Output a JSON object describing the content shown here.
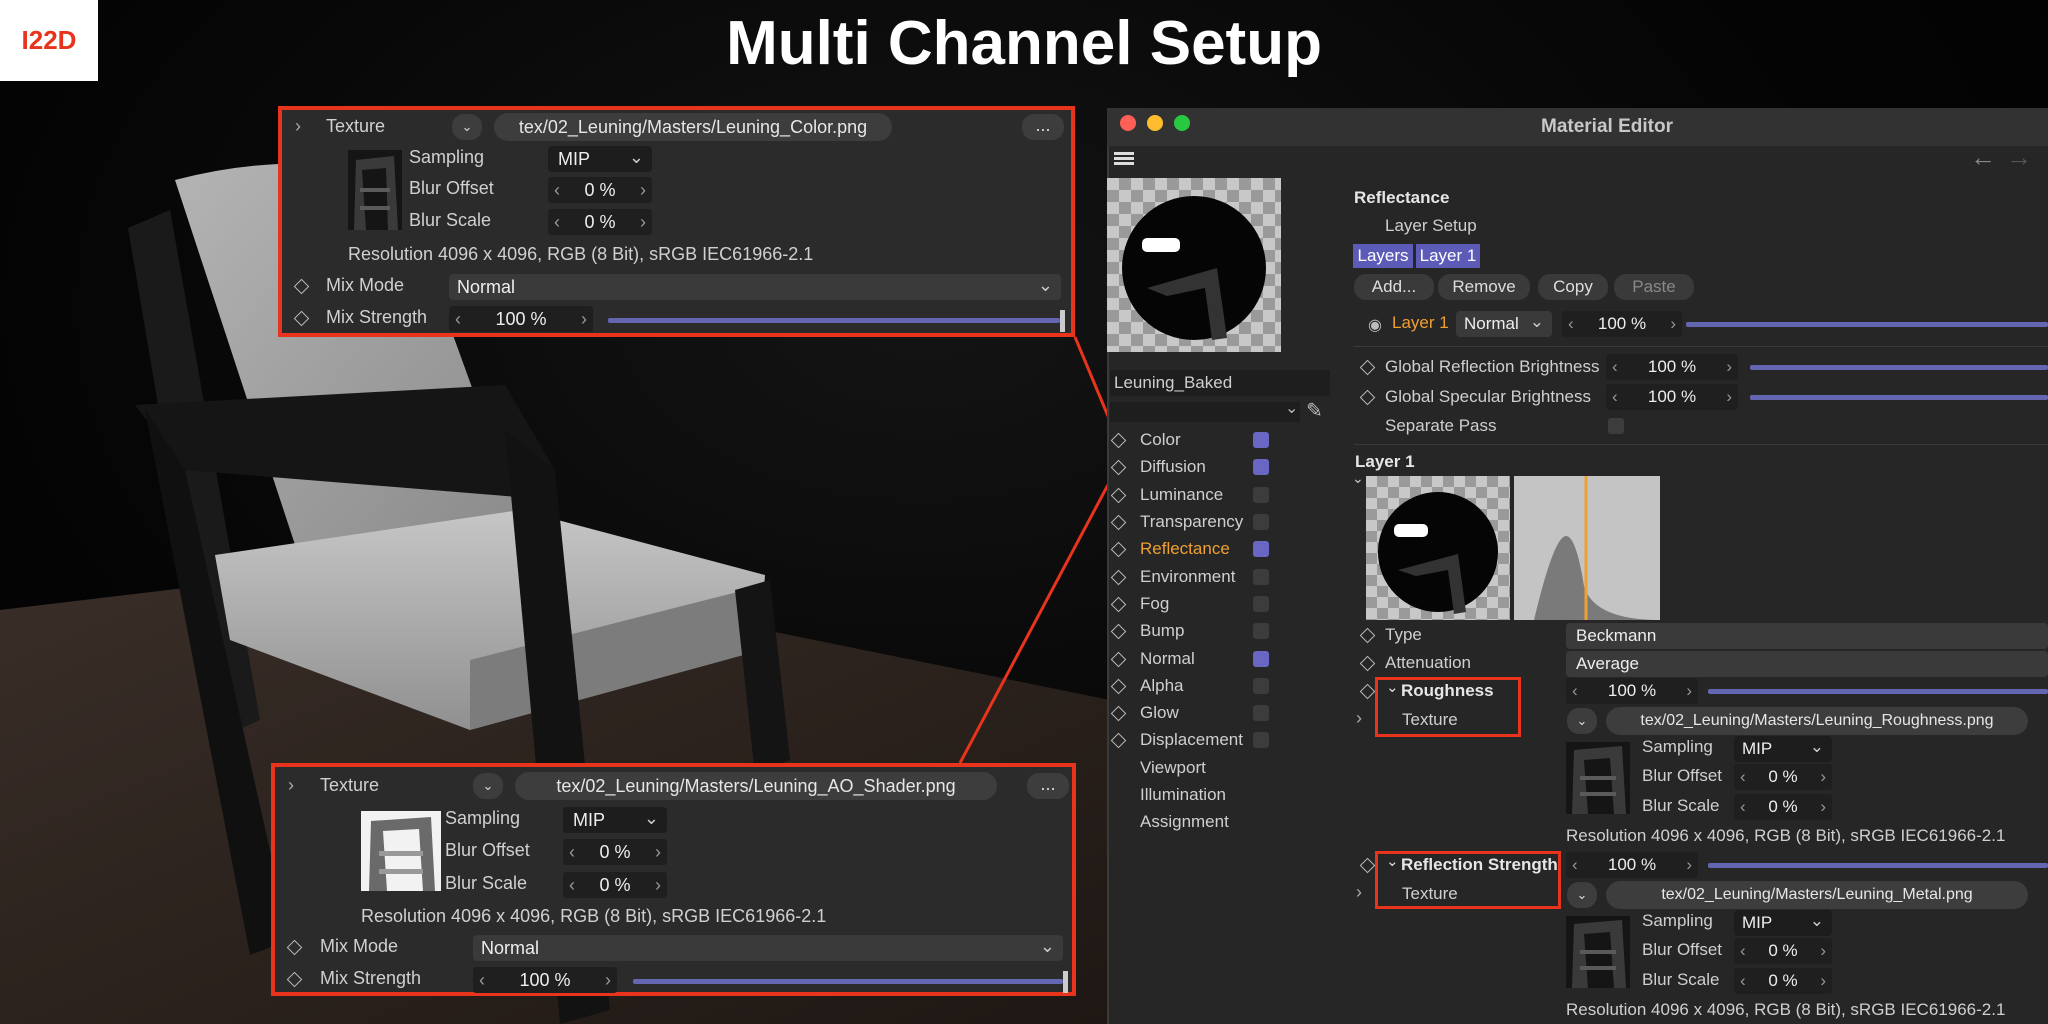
{
  "header": {
    "logo": "I22D",
    "title": "Multi Channel Setup"
  },
  "colors": {
    "accent_red": "#e8341c",
    "slider_blue": "#6566b2",
    "reflectance_orange": "#f0a030",
    "panel_bg": "#262626"
  },
  "callout_top": {
    "texture_label": "Texture",
    "path": "tex/02_Leuning/Masters/Leuning_Color.png",
    "more": "...",
    "sampling_label": "Sampling",
    "sampling_value": "MIP",
    "blur_offset_label": "Blur Offset",
    "blur_offset_value": "0 %",
    "blur_scale_label": "Blur Scale",
    "blur_scale_value": "0 %",
    "resolution": "Resolution 4096 x 4096, RGB (8 Bit), sRGB IEC61966-2.1",
    "mix_mode_label": "Mix Mode",
    "mix_mode_value": "Normal",
    "mix_strength_label": "Mix Strength",
    "mix_strength_value": "100 %",
    "mix_strength_level": 1.0
  },
  "callout_bottom": {
    "texture_label": "Texture",
    "path": "tex/02_Leuning/Masters/Leuning_AO_Shader.png",
    "more": "...",
    "sampling_label": "Sampling",
    "sampling_value": "MIP",
    "blur_offset_label": "Blur Offset",
    "blur_offset_value": "0 %",
    "blur_scale_label": "Blur Scale",
    "blur_scale_value": "0 %",
    "resolution": "Resolution 4096 x 4096, RGB (8 Bit), sRGB IEC61966-2.1",
    "mix_mode_label": "Mix Mode",
    "mix_mode_value": "Normal",
    "mix_strength_label": "Mix Strength",
    "mix_strength_value": "100 %",
    "mix_strength_level": 1.0
  },
  "material_editor": {
    "title": "Material Editor",
    "material_name": "Leuning_Baked",
    "channels": [
      {
        "label": "Color",
        "checked": true
      },
      {
        "label": "Diffusion",
        "checked": true
      },
      {
        "label": "Luminance",
        "checked": false
      },
      {
        "label": "Transparency",
        "checked": false
      },
      {
        "label": "Reflectance",
        "checked": true
      },
      {
        "label": "Environment",
        "checked": false
      },
      {
        "label": "Fog",
        "checked": false
      },
      {
        "label": "Bump",
        "checked": false
      },
      {
        "label": "Normal",
        "checked": true
      },
      {
        "label": "Alpha",
        "checked": false
      },
      {
        "label": "Glow",
        "checked": false
      },
      {
        "label": "Displacement",
        "checked": false
      },
      {
        "label": "Viewport"
      },
      {
        "label": "Illumination"
      },
      {
        "label": "Assignment"
      }
    ],
    "reflectance": {
      "heading": "Reflectance",
      "layer_setup": "Layer Setup",
      "tab_layers": "Layers",
      "tab_layer1": "Layer 1",
      "btn_add": "Add...",
      "btn_remove": "Remove",
      "btn_copy": "Copy",
      "btn_paste": "Paste",
      "layer_name": "Layer 1",
      "layer_mode": "Normal",
      "layer_value": "100 %",
      "global_refl_label": "Global Reflection Brightness",
      "global_refl_value": "100 %",
      "global_spec_label": "Global Specular Brightness",
      "global_spec_value": "100 %",
      "separate_pass_label": "Separate Pass"
    },
    "layer1": {
      "heading": "Layer 1",
      "type_label": "Type",
      "type_value": "Beckmann",
      "attenuation_label": "Attenuation",
      "attenuation_value": "Average",
      "roughness_label": "Roughness",
      "roughness_value": "100 %",
      "roughness_texture_label": "Texture",
      "roughness_path": "tex/02_Leuning/Masters/Leuning_Roughness.png",
      "r_sampling_label": "Sampling",
      "r_sampling_value": "MIP",
      "r_blur_offset_label": "Blur Offset",
      "r_blur_offset_value": "0 %",
      "r_blur_scale_label": "Blur Scale",
      "r_blur_scale_value": "0 %",
      "r_resolution": "Resolution 4096 x 4096, RGB (8 Bit), sRGB IEC61966-2.1",
      "refl_strength_label": "Reflection Strength",
      "refl_strength_value": "100 %",
      "refl_texture_label": "Texture",
      "refl_path": "tex/02_Leuning/Masters/Leuning_Metal.png",
      "m_sampling_label": "Sampling",
      "m_sampling_value": "MIP",
      "m_blur_offset_label": "Blur Offset",
      "m_blur_offset_value": "0 %",
      "m_blur_scale_label": "Blur Scale",
      "m_blur_scale_value": "0 %",
      "m_resolution": "Resolution 4096 x 4096, RGB (8 Bit), sRGB IEC61966-2.1"
    }
  }
}
